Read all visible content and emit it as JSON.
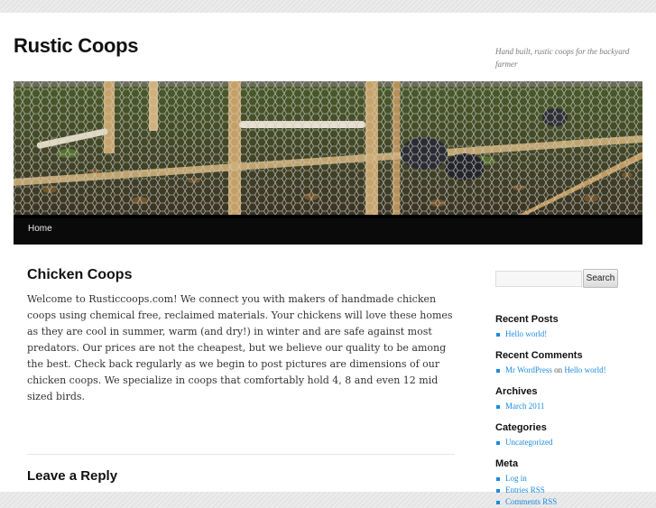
{
  "site": {
    "title": "Rustic Coops",
    "description": "Hand built, rustic coops for the backyard farmer"
  },
  "nav": {
    "home": "Home"
  },
  "post": {
    "title": "Chicken Coops",
    "body": "Welcome to Rusticcoops.com!  We connect you with makers of handmade chicken coops using chemical free, reclaimed materials.  Your chickens will love these homes as they are cool in summer, warm (and dry!) in winter and are safe against most predators.  Our prices are not the cheapest, but we believe our quality to be among the best.  Check back regularly as we begin to post pictures are dimensions of our chicken coops.  We specialize in coops that comfortably hold 4, 8 and even 12 mid sized birds."
  },
  "reply": {
    "title": "Leave a Reply"
  },
  "sidebar": {
    "search": {
      "placeholder": "",
      "button": "Search"
    },
    "recent_posts": {
      "title": "Recent Posts",
      "items": [
        "Hello world!"
      ]
    },
    "recent_comments": {
      "title": "Recent Comments",
      "author": "Mr WordPress",
      "on": "on",
      "post": "Hello world!"
    },
    "archives": {
      "title": "Archives",
      "items": [
        "March 2011"
      ]
    },
    "categories": {
      "title": "Categories",
      "items": [
        "Uncategorized"
      ]
    },
    "meta": {
      "title": "Meta",
      "items": [
        "Log in",
        "Entries RSS",
        "Comments RSS"
      ]
    }
  },
  "colors": {
    "link": "#1b8be0",
    "nav_bg": "#0a0a0a",
    "text": "#333333"
  }
}
